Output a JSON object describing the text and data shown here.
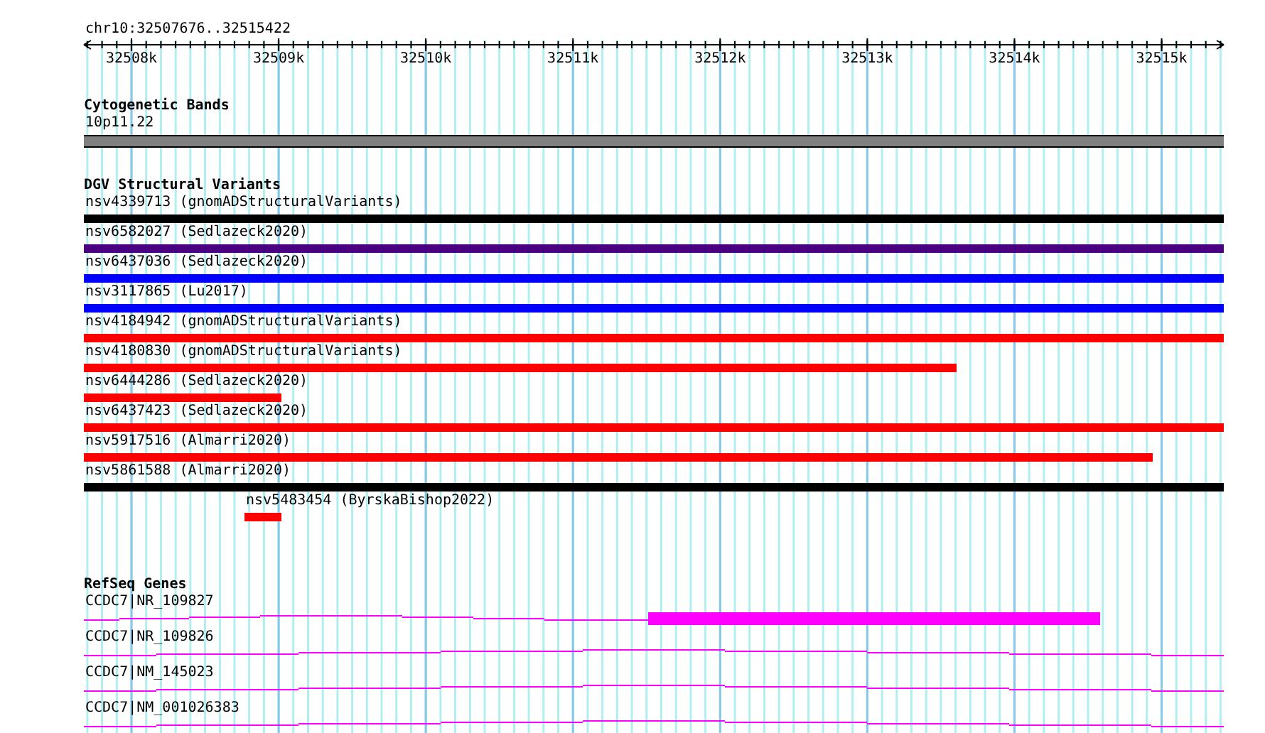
{
  "ruler": {
    "location": "chr10:32507676..32515422",
    "ticks": [
      "32508k",
      "32509k",
      "32510k",
      "32511k",
      "32512k",
      "32513k",
      "32514k",
      "32515k"
    ]
  },
  "bands": {
    "title": "Cytogenetic Bands",
    "label": "10p11.22"
  },
  "variants": {
    "title": "DGV Structural Variants",
    "features": [
      {
        "label": "nsv4339713 (gnomADStructuralVariants)",
        "color": "#000000"
      },
      {
        "label": "nsv6582027 (Sedlazeck2020)",
        "color": "#4b0082"
      },
      {
        "label": "nsv6437036 (Sedlazeck2020)",
        "color": "#0000ff"
      },
      {
        "label": "nsv3117865 (Lu2017)",
        "color": "#0000ff"
      },
      {
        "label": "nsv4184942 (gnomADStructuralVariants)",
        "color": "#ff0000"
      },
      {
        "label": "nsv4180830 (gnomADStructuralVariants)",
        "color": "#ff0000"
      },
      {
        "label": "nsv6444286 (Sedlazeck2020)",
        "color": "#ff0000"
      },
      {
        "label": "nsv6437423 (Sedlazeck2020)",
        "color": "#ff0000"
      },
      {
        "label": "nsv5917516 (Almarri2020)",
        "color": "#ff0000"
      },
      {
        "label": "nsv5861588 (Almarri2020)",
        "color": "#000000"
      },
      {
        "label": "nsv5483454 (ByrskaBishop2022)",
        "color": "#ff0000"
      }
    ]
  },
  "genes": {
    "title": "RefSeq Genes",
    "features": [
      {
        "label": "CCDC7|NR_109827"
      },
      {
        "label": "CCDC7|NR_109826"
      },
      {
        "label": "CCDC7|NM_145023"
      },
      {
        "label": "CCDC7|NM_001026383"
      }
    ]
  }
}
